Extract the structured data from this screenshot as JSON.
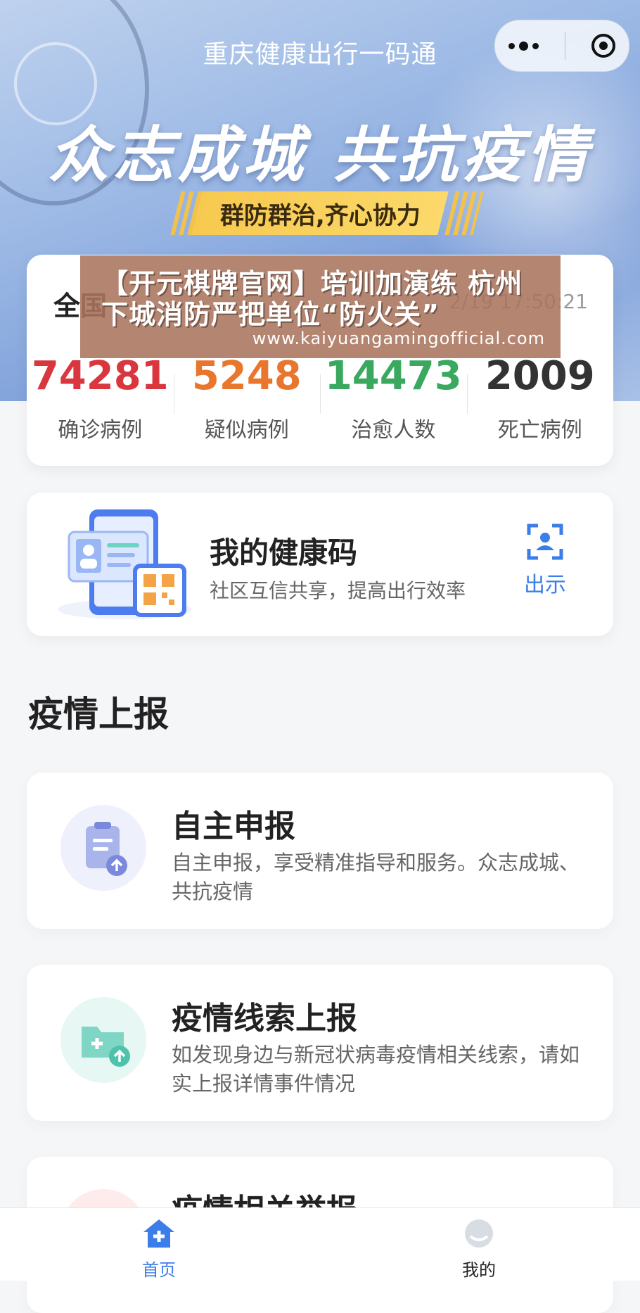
{
  "header": {
    "title": "重庆健康出行一码通"
  },
  "banner": {
    "slogan": "众志成城 共抗疫情",
    "tagline": "群防群治,齐心协力"
  },
  "stats": {
    "label": "全国",
    "time": "2/19 17:50:21",
    "items": [
      {
        "value": "74281",
        "label": "确诊病例",
        "color": "#d9363e"
      },
      {
        "value": "5248",
        "label": "疑似病例",
        "color": "#e8762d"
      },
      {
        "value": "14473",
        "label": "治愈人数",
        "color": "#3aa85f"
      },
      {
        "value": "2009",
        "label": "死亡病例",
        "color": "#333333"
      }
    ]
  },
  "overlay": {
    "text": "【开元棋牌官网】培训加演练 杭州下城消防严把单位“防火关”",
    "url": "www.kaiyuangamingofficial.com"
  },
  "health_code": {
    "title": "我的健康码",
    "subtitle": "社区互信共享，提高出行效率",
    "action": "出示"
  },
  "report": {
    "section_title": "疫情上报",
    "cards": [
      {
        "title": "自主申报",
        "desc": "自主申报，享受精准指导和服务。众志成城、共抗疫情",
        "icon": "clipboard-upload-icon"
      },
      {
        "title": "疫情线索上报",
        "desc": "如发现身边与新冠状病毒疫情相关线索，请如实上报详情事件情况",
        "icon": "folder-plus-upload-icon"
      },
      {
        "title": "疫情相关举报",
        "desc": "",
        "icon": "report-icon"
      }
    ]
  },
  "tabs": [
    {
      "label": "首页",
      "active": true
    },
    {
      "label": "我的",
      "active": false
    }
  ],
  "colors": {
    "accent": "#3b7de9",
    "background": "#f5f6f8"
  }
}
